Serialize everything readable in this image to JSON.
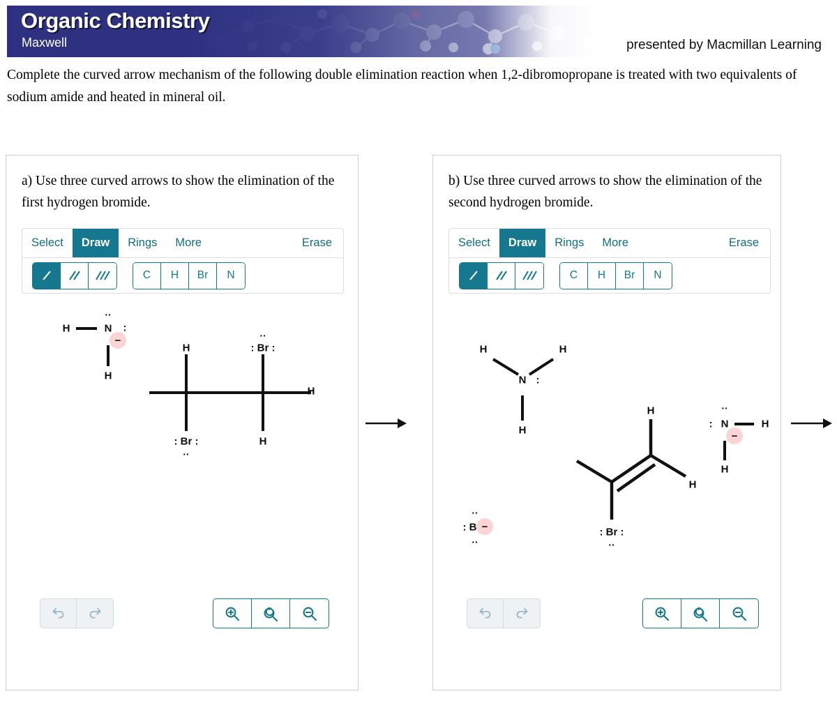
{
  "banner": {
    "title": "Organic Chemistry",
    "subtitle": "Maxwell",
    "presented_by": "presented by Macmillan Learning",
    "bg_color": "#2e3180"
  },
  "prompt": "Complete the curved arrow mechanism of the following double elimination reaction when 1,2-dibromopropane is treated with two equivalents of sodium amide and heated in mineral oil.",
  "accent_color": "#15788e",
  "charge_badge_color": "#fbd5d5",
  "toolbar": {
    "tabs": [
      {
        "label": "Select",
        "active": false
      },
      {
        "label": "Draw",
        "active": true
      },
      {
        "label": "Rings",
        "active": false
      },
      {
        "label": "More",
        "active": false
      }
    ],
    "erase_label": "Erase",
    "bond_tools": [
      {
        "name": "single-bond",
        "active": true
      },
      {
        "name": "double-bond",
        "active": false
      },
      {
        "name": "triple-bond",
        "active": false
      }
    ],
    "elements": [
      "C",
      "H",
      "Br",
      "N"
    ],
    "undo_icons": [
      "undo-icon",
      "redo-icon"
    ],
    "zoom_icons": [
      "zoom-in-icon",
      "zoom-reset-icon",
      "zoom-out-icon"
    ]
  },
  "panel_a": {
    "question": "a) Use three curved arrows to show the elimination of the first hydrogen bromide.",
    "structures": {
      "amide_ion": {
        "atoms": [
          "H",
          "N",
          "H"
        ],
        "charge": "−",
        "lone_pairs": 2
      },
      "dibromopropane": {
        "name": "1,2-dibromopropane",
        "labels": [
          "H",
          "Br",
          "Br",
          "H",
          "H"
        ]
      }
    }
  },
  "panel_b": {
    "question": "b) Use three curved arrows to show the elimination of the second hydrogen bromide.",
    "structures": {
      "ammonia": {
        "atoms": [
          "H",
          "H",
          "N",
          "H"
        ]
      },
      "vinyl_bromide": {
        "labels": [
          "H",
          "H",
          "Br"
        ]
      },
      "bromide_ion": {
        "label": "Br",
        "charge": "−"
      },
      "amide_ion": {
        "atoms": [
          "N",
          "H",
          "H"
        ],
        "charge": "−"
      }
    }
  },
  "glyphs": {
    "colon": ":",
    "dots": "··",
    "minus": "−"
  }
}
